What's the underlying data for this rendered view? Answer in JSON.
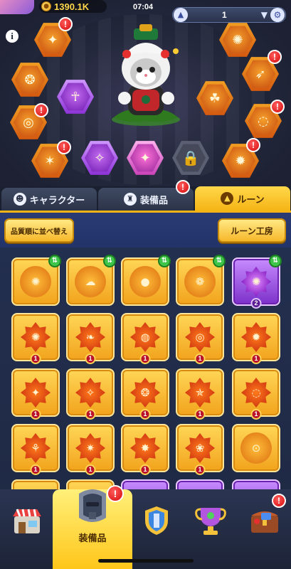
{
  "status": {
    "currency_value": "1390.1K",
    "time": "07:04"
  },
  "preset": {
    "number": "1",
    "dropdown_icon": "chevron-down-icon",
    "settings_icon": "gear-icon"
  },
  "info_label": "i",
  "tabs": [
    {
      "label": "キャラクター",
      "icon": "character-icon",
      "active": false
    },
    {
      "label": "装備品",
      "icon": "equipment-icon",
      "active": false,
      "badge": "!"
    },
    {
      "label": "ルーン",
      "icon": "rune-icon",
      "active": true
    }
  ],
  "actions": {
    "sort_label": "品質順に並べ替え",
    "workshop_label": "ルーン工房"
  },
  "slot_glyphs": {
    "left": [
      "✦",
      "❂",
      "◎",
      "✶"
    ],
    "right": [
      "✺",
      "➶",
      "☘",
      "◌",
      "✹"
    ],
    "center": [
      "☥",
      "✧",
      "✦",
      "🔒"
    ]
  },
  "runes": {
    "row1": [
      {
        "glyph": "✺",
        "swap": true,
        "level": ""
      },
      {
        "glyph": "☁",
        "swap": true,
        "level": ""
      },
      {
        "glyph": "●",
        "swap": true,
        "level": ""
      },
      {
        "glyph": "❁",
        "swap": true,
        "level": ""
      },
      {
        "glyph": "✺",
        "swap": false,
        "level": "2",
        "purple": true
      }
    ],
    "row2": [
      {
        "glyph": "✺",
        "level": "1"
      },
      {
        "glyph": "❧",
        "level": "1"
      },
      {
        "glyph": "◍",
        "level": "1"
      },
      {
        "glyph": "◎",
        "level": "1"
      },
      {
        "glyph": "✹",
        "level": "1"
      }
    ],
    "row3": [
      {
        "glyph": "✦",
        "level": "1"
      },
      {
        "glyph": "✧",
        "level": "1"
      },
      {
        "glyph": "❂",
        "level": "1"
      },
      {
        "glyph": "✯",
        "level": "1"
      },
      {
        "glyph": "◌",
        "level": "1"
      }
    ],
    "row4": [
      {
        "glyph": "⚘",
        "level": "1"
      },
      {
        "glyph": "✷",
        "level": "1"
      },
      {
        "glyph": "✸",
        "level": "1"
      },
      {
        "glyph": "❀",
        "level": "1"
      },
      {
        "glyph": "⊙",
        "level": ""
      }
    ]
  },
  "bottom_nav": {
    "items": [
      {
        "icon": "shop-icon"
      },
      {
        "icon": "equipment-icon",
        "label": "装備品",
        "active": true,
        "badge": "!"
      },
      {
        "icon": "shield-icon"
      },
      {
        "icon": "trophy-icon"
      },
      {
        "icon": "chest-icon",
        "badge": "!"
      }
    ]
  },
  "badge_text": "!",
  "colors": {
    "accent_gold": "#f5b416",
    "rune_orange": "#e4581a",
    "rune_purple": "#8a22c6",
    "notification_red": "#d60b0b",
    "swap_green": "#3fc64a"
  }
}
